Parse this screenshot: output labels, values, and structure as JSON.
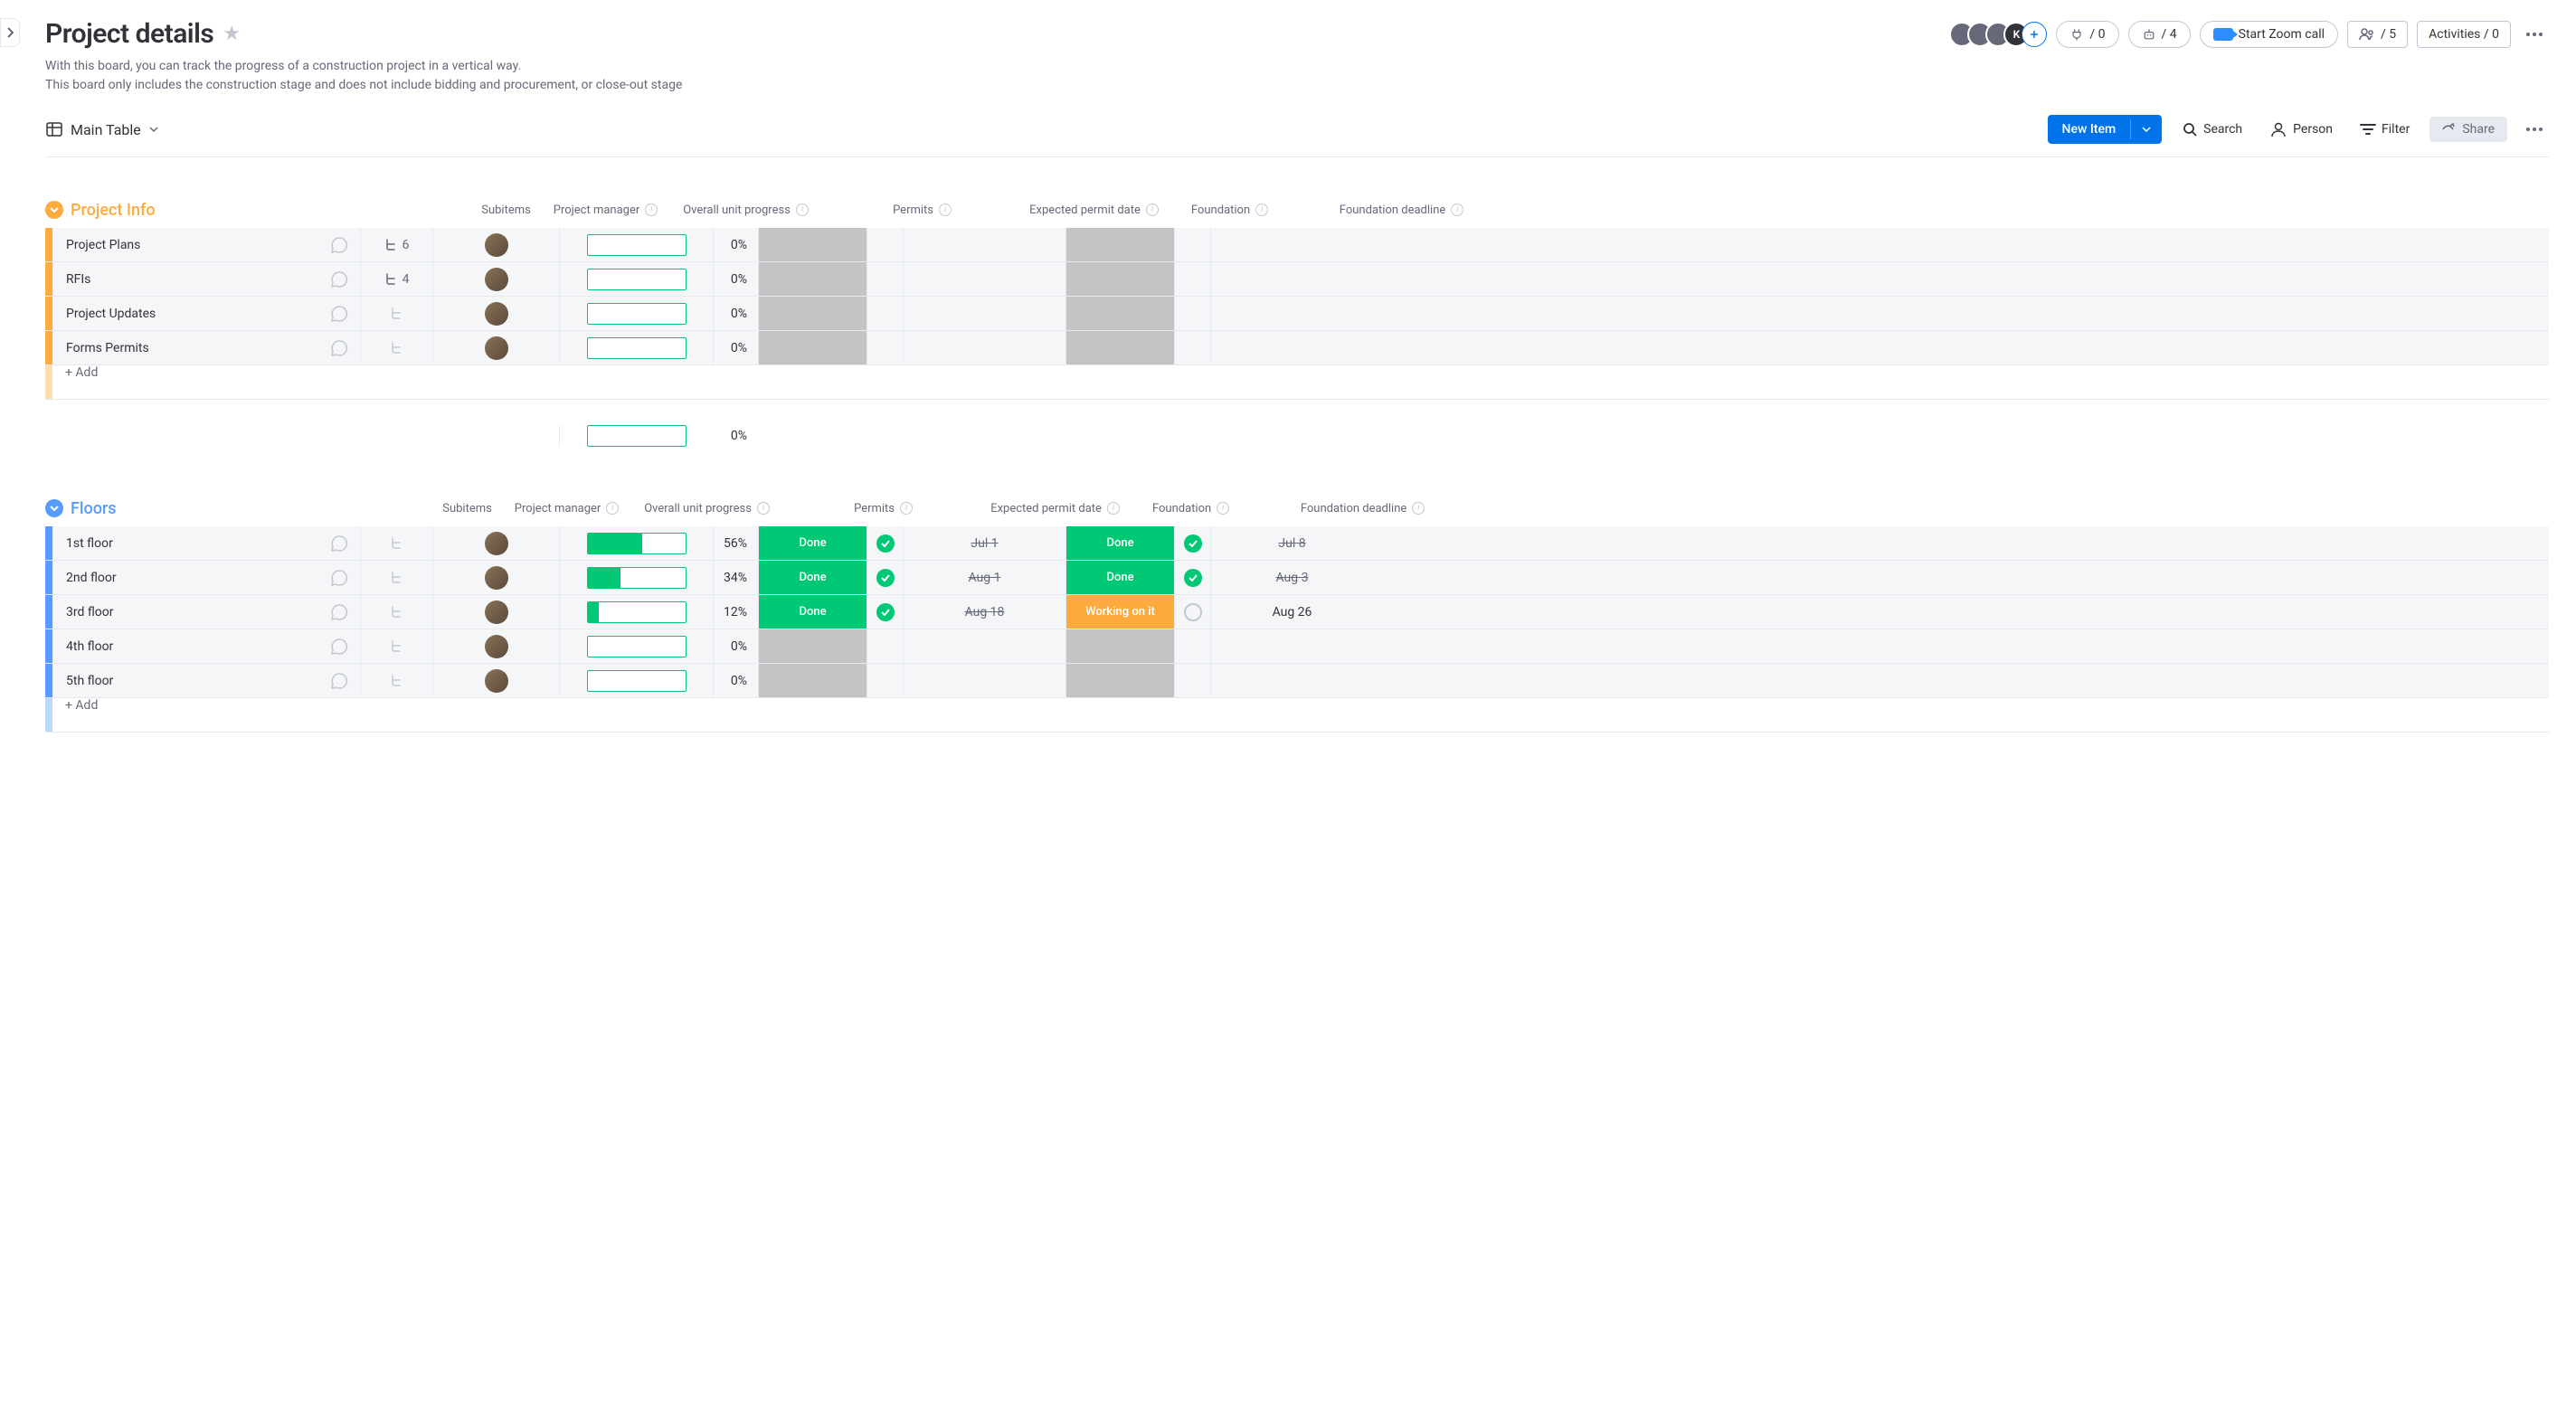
{
  "header": {
    "title": "Project details",
    "desc_line1": "With this board, you can track the progress of a construction project in a vertical way.",
    "desc_line2": "This board only includes the construction stage and does not include bidding and procurement, or close-out stage",
    "integrations_count": "/ 0",
    "automations_count": "/ 4",
    "zoom_label": "Start Zoom call",
    "members_count": "/ 5",
    "activities_label": "Activities / 0"
  },
  "toolbar": {
    "view_label": "Main Table",
    "new_item": "New Item",
    "search": "Search",
    "person": "Person",
    "filter": "Filter",
    "share": "Share"
  },
  "columns": {
    "subitems": "Subitems",
    "pm": "Project manager",
    "progress": "Overall unit progress",
    "permits": "Permits",
    "permit_date": "Expected permit date",
    "foundation": "Foundation",
    "foundation_deadline": "Foundation deadline"
  },
  "groups": [
    {
      "id": "project_info",
      "title": "Project Info",
      "color": "orange",
      "add_label": "+ Add",
      "summary_progress": 0,
      "rows": [
        {
          "name": "Project Plans",
          "subitems": "6",
          "progress": 0
        },
        {
          "name": "RFIs",
          "subitems": "4",
          "progress": 0
        },
        {
          "name": "Project Updates",
          "subitems": "",
          "progress": 0
        },
        {
          "name": "Forms Permits",
          "subitems": "",
          "progress": 0
        }
      ]
    },
    {
      "id": "floors",
      "title": "Floors",
      "color": "blue",
      "add_label": "+ Add",
      "rows": [
        {
          "name": "1st floor",
          "progress": 56,
          "permits": "Done",
          "permit_check": true,
          "permit_date": "Jul 1",
          "permit_struck": true,
          "foundation": "Done",
          "foundation_check": true,
          "foundation_date": "Jul 8",
          "foundation_struck": true
        },
        {
          "name": "2nd floor",
          "progress": 34,
          "permits": "Done",
          "permit_check": true,
          "permit_date": "Aug 1",
          "permit_struck": true,
          "foundation": "Done",
          "foundation_check": true,
          "foundation_date": "Aug 3",
          "foundation_struck": true
        },
        {
          "name": "3rd floor",
          "progress": 12,
          "permits": "Done",
          "permit_check": true,
          "permit_date": "Aug 18",
          "permit_struck": true,
          "foundation": "Working on it",
          "foundation_status": "working",
          "foundation_check": false,
          "foundation_date": "Aug 26",
          "foundation_struck": false
        },
        {
          "name": "4th floor",
          "progress": 0,
          "permits": "",
          "foundation": ""
        },
        {
          "name": "5th floor",
          "progress": 0,
          "permits": "",
          "foundation": ""
        }
      ]
    }
  ]
}
